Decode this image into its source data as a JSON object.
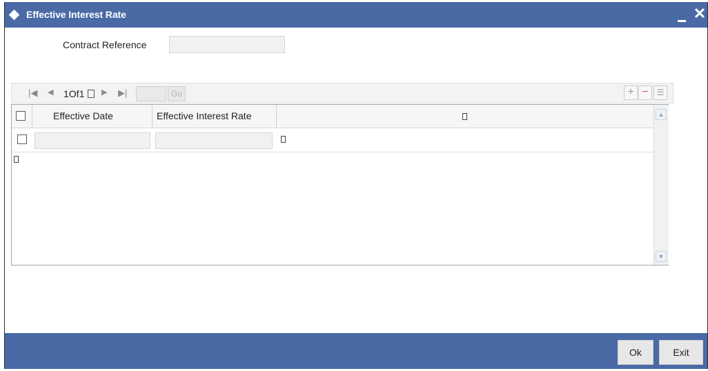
{
  "window": {
    "title": "Effective Interest Rate",
    "close_glyph": "✕",
    "colors": {
      "titlebar": "#4a6aa6",
      "footer": "#4a6aa6"
    }
  },
  "form": {
    "contract_reference_label": "Contract Reference",
    "contract_reference_value": ""
  },
  "pager": {
    "page_text": "1Of1",
    "goto_value": "",
    "go_label": "Go",
    "icons": [
      "first-page-icon",
      "previous-page-icon",
      "next-page-icon",
      "last-page-icon",
      "add-row-icon",
      "delete-row-icon",
      "single-view-icon"
    ]
  },
  "grid": {
    "columns": [
      "Effective Date",
      "Effective Interest Rate"
    ],
    "rows": [
      {
        "effective_date": "",
        "effective_interest_rate": ""
      }
    ]
  },
  "footer": {
    "ok_label": "Ok",
    "exit_label": "Exit"
  }
}
